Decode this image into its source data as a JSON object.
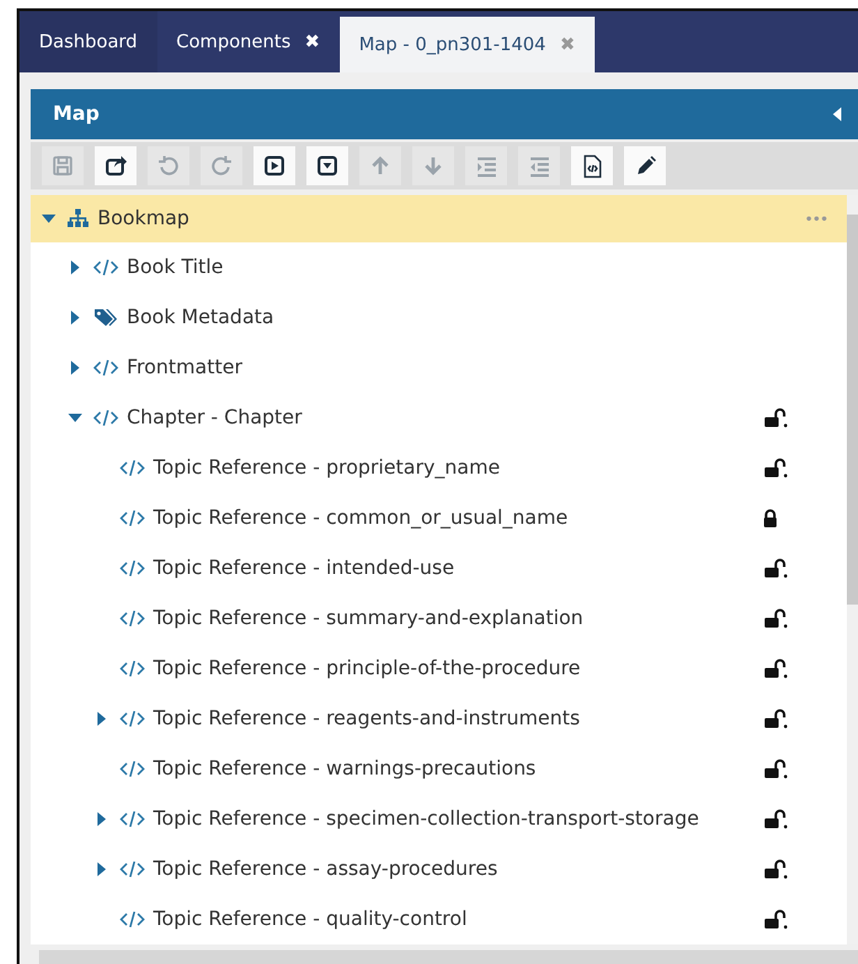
{
  "tabs": [
    {
      "label": "Dashboard",
      "selected": false
    },
    {
      "label": "Components",
      "selected": false,
      "close": "✖"
    },
    {
      "label": "Map - 0_pn301-1404",
      "selected": true,
      "close": "✖"
    }
  ],
  "panel": {
    "title": "Map"
  },
  "toolbar": [
    {
      "kind": "save",
      "disabled": true
    },
    {
      "kind": "share",
      "disabled": false
    },
    {
      "kind": "undo",
      "disabled": true
    },
    {
      "kind": "redo",
      "disabled": true
    },
    {
      "kind": "step-into",
      "disabled": false
    },
    {
      "kind": "dropdown",
      "disabled": false
    },
    {
      "kind": "up",
      "disabled": true
    },
    {
      "kind": "down",
      "disabled": true
    },
    {
      "kind": "indent",
      "disabled": true
    },
    {
      "kind": "outdent",
      "disabled": true
    },
    {
      "kind": "code",
      "disabled": false
    },
    {
      "kind": "edit",
      "disabled": false
    }
  ],
  "tree": [
    {
      "label": "Bookmap",
      "kind": "map",
      "expanded": true,
      "selected": true,
      "menu": "•••",
      "children": [
        {
          "label": "Book Title",
          "kind": "element",
          "expanded": false,
          "selected": false
        },
        {
          "label": "Book Metadata",
          "kind": "metadata",
          "expanded": false,
          "selected": false
        },
        {
          "label": "Frontmatter",
          "kind": "element",
          "expanded": false,
          "selected": false
        },
        {
          "label": "Chapter - Chapter",
          "kind": "element",
          "expanded": true,
          "selected": false,
          "locked": false,
          "children": [
            {
              "label": "Topic Reference - proprietary_name",
              "kind": "element",
              "selected": false,
              "locked": false
            },
            {
              "label": "Topic Reference - common_or_usual_name",
              "kind": "element",
              "selected": false,
              "locked": true
            },
            {
              "label": "Topic Reference - intended-use",
              "kind": "element",
              "selected": false,
              "locked": false
            },
            {
              "label": "Topic Reference - summary-and-explanation",
              "kind": "element",
              "selected": false,
              "locked": false
            },
            {
              "label": "Topic Reference - principle-of-the-procedure",
              "kind": "element",
              "selected": false,
              "locked": false
            },
            {
              "label": "Topic Reference - reagents-and-instruments",
              "kind": "element",
              "expanded": false,
              "selected": false,
              "locked": false
            },
            {
              "label": "Topic Reference - warnings-precautions",
              "kind": "element",
              "selected": false,
              "locked": false
            },
            {
              "label": "Topic Reference - specimen-collection-transport-storage",
              "kind": "element",
              "expanded": false,
              "selected": false,
              "locked": false
            },
            {
              "label": "Topic Reference - assay-procedures",
              "kind": "element",
              "expanded": false,
              "selected": false,
              "locked": false
            },
            {
              "label": "Topic Reference - quality-control",
              "kind": "element",
              "selected": false,
              "locked": false
            }
          ]
        }
      ]
    }
  ]
}
